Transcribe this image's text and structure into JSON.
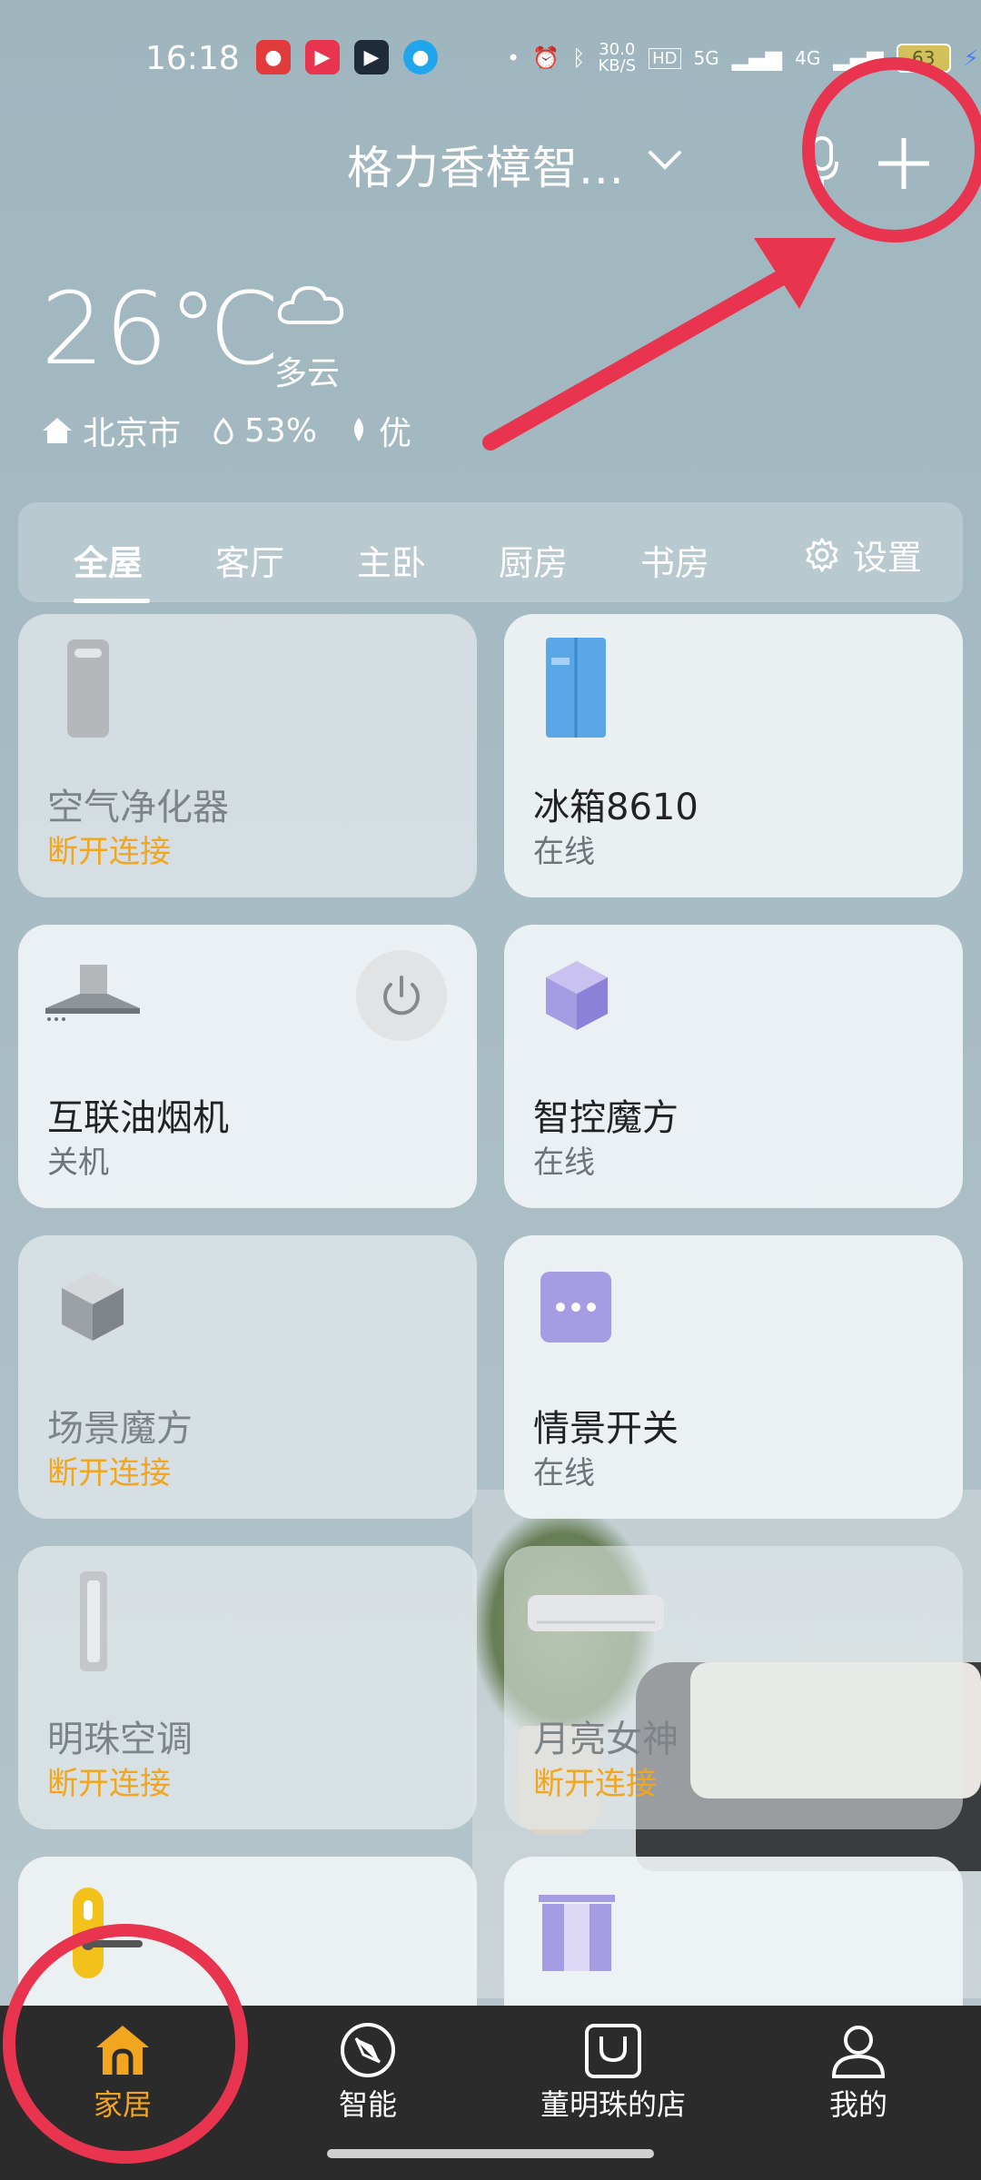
{
  "status_bar": {
    "time": "16:18",
    "speed": "30.0\nKB/S",
    "network1": "5G",
    "network2": "4G",
    "battery": "63"
  },
  "header": {
    "title": "格力香樟智...",
    "add_label": "+"
  },
  "weather": {
    "temperature": "26℃",
    "condition": "多云",
    "city": "北京市",
    "humidity": "53%",
    "air_quality": "优"
  },
  "tabs": {
    "items": [
      {
        "label": "全屋"
      },
      {
        "label": "客厅"
      },
      {
        "label": "主卧"
      },
      {
        "label": "厨房"
      },
      {
        "label": "书房"
      }
    ],
    "settings_label": "设置"
  },
  "devices": [
    {
      "name": "空气净化器",
      "status": "断开连接"
    },
    {
      "name": "冰箱8610",
      "status": "在线"
    },
    {
      "name": "互联油烟机",
      "status": "关机"
    },
    {
      "name": "智控魔方",
      "status": "在线"
    },
    {
      "name": "场景魔方",
      "status": "断开连接"
    },
    {
      "name": "情景开关",
      "status": "在线"
    },
    {
      "name": "明珠空调",
      "status": "断开连接"
    },
    {
      "name": "月亮女神",
      "status": "断开连接"
    }
  ],
  "bottom_nav": [
    {
      "label": "家居"
    },
    {
      "label": "智能"
    },
    {
      "label": "董明珠的店"
    },
    {
      "label": "我的"
    }
  ],
  "colors": {
    "accent": "#f2a51f",
    "annotation": "#e8344f",
    "online_text": "#6e7578"
  }
}
